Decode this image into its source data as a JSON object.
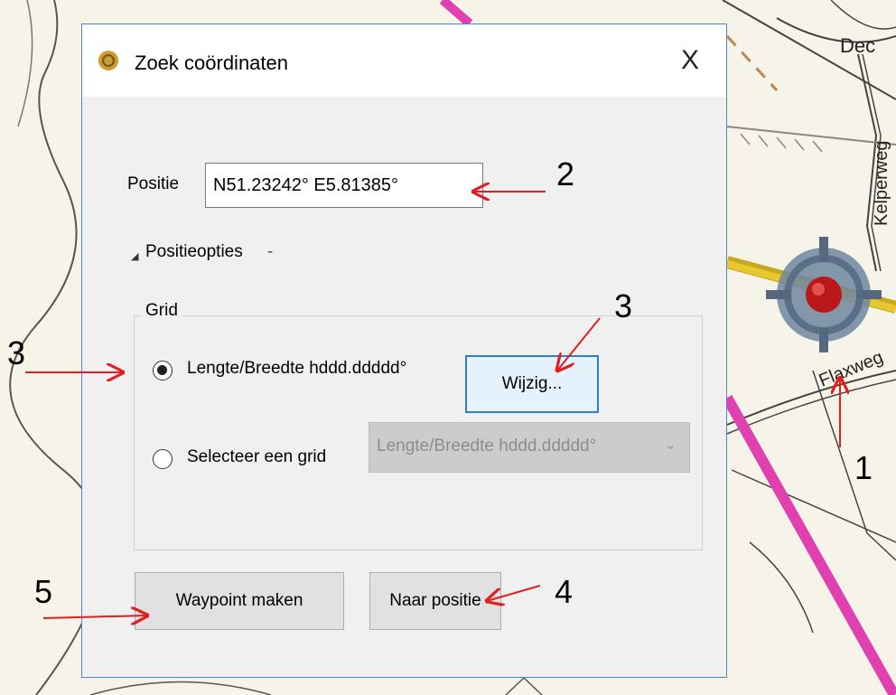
{
  "dialog": {
    "title": "Zoek coördinaten",
    "close_glyph": "X",
    "position_label": "Positie",
    "position_value": "N51.23242° E5.81385°",
    "options_toggle": "Positieopties",
    "options_dash": "-",
    "grid": {
      "legend": "Grid",
      "option1_label": "Lengte/Breedte hddd.ddddd°",
      "option1_selected": true,
      "change_button": "Wijzig...",
      "option2_label": "Selecteer een grid",
      "option2_selected": false,
      "grid_select_value": "Lengte/Breedte hddd.ddddd°"
    },
    "waypoint_button": "Waypoint maken",
    "goto_button": "Naar positie"
  },
  "map": {
    "labels": [
      "Dec",
      "Kelperweg",
      "Flaxweg"
    ]
  },
  "annotations": [
    "1",
    "2",
    "3",
    "3",
    "4",
    "5"
  ],
  "colors": {
    "accent": "#2a7fd4",
    "arrow": "#e02020",
    "map_bg": "#f4f1e6",
    "map_highway": "#e040b0"
  }
}
